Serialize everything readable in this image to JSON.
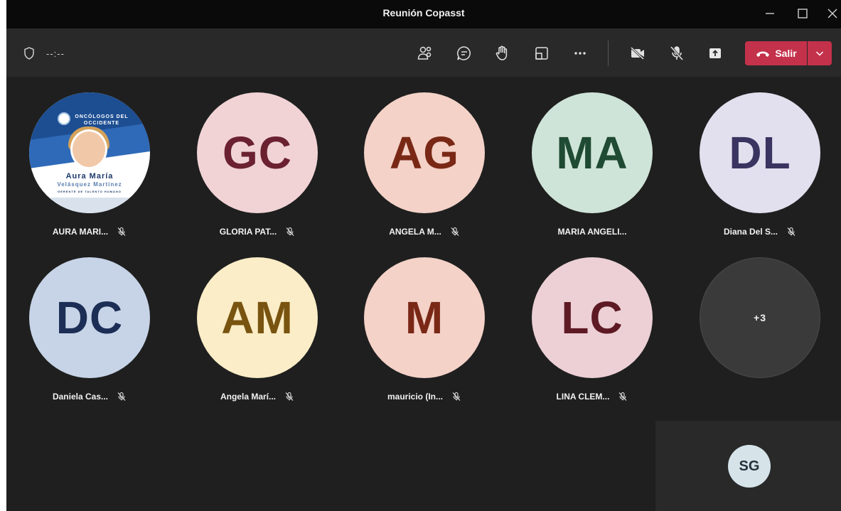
{
  "window": {
    "title": "Reunión Copasst"
  },
  "toolbar": {
    "timer": "--:--",
    "leave_label": "Salir",
    "icons": [
      "people-icon",
      "chat-icon",
      "raise-hand-icon",
      "rooms-icon",
      "more-icon",
      "camera-off-icon",
      "mic-off-icon",
      "share-icon"
    ]
  },
  "participants": [
    {
      "name": "AURA MARI...",
      "initials": "",
      "bg": "#ffffff",
      "fg": "#1d3a6b",
      "muted": true,
      "photo": true
    },
    {
      "name": "GLORIA PAT...",
      "initials": "GC",
      "bg": "#f1d3d6",
      "fg": "#6b2130",
      "muted": true
    },
    {
      "name": "ANGELA M...",
      "initials": "AG",
      "bg": "#f4d2c8",
      "fg": "#7a2816",
      "muted": true
    },
    {
      "name": "MARIA ANGELI...",
      "initials": "MA",
      "bg": "#cfe4d8",
      "fg": "#1f4a33",
      "muted": false
    },
    {
      "name": "Diana Del S...",
      "initials": "DL",
      "bg": "#e2e0ee",
      "fg": "#3a3461",
      "muted": true
    },
    {
      "name": "Daniela Cas...",
      "initials": "DC",
      "bg": "#c7d4e8",
      "fg": "#1c2e55",
      "muted": true
    },
    {
      "name": "Angela Marí...",
      "initials": "AM",
      "bg": "#fbedc7",
      "fg": "#785410",
      "muted": true
    },
    {
      "name": "mauricio (In...",
      "initials": "M",
      "bg": "#f4d2c8",
      "fg": "#7a2816",
      "muted": true
    },
    {
      "name": "LINA CLEM...",
      "initials": "LC",
      "bg": "#ecd0d5",
      "fg": "#5e1a24",
      "muted": true
    }
  ],
  "photo_card": {
    "org": "ONCÓLOGOS DEL OCCIDENTE",
    "name": "Aura María",
    "surname": "Velásquez Martínez",
    "role": "GERENTE DE TALENTO HUMANO"
  },
  "overflow": {
    "label": "+3"
  },
  "self": {
    "initials": "SG"
  },
  "colors": {
    "leave_red": "#c4314b",
    "stage_bg": "#1f1f1f",
    "toolbar_bg": "#292929"
  }
}
